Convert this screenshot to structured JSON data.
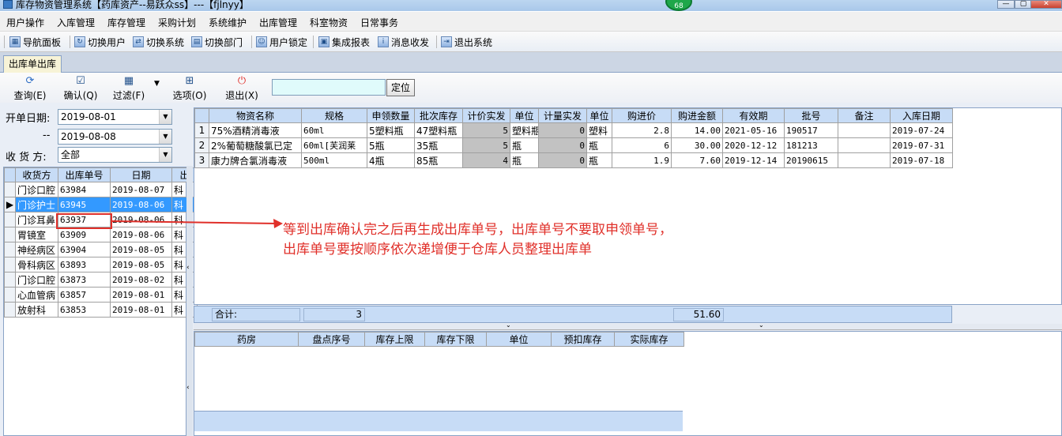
{
  "window": {
    "title": "库存物资管理系统【药库资产--易跃众ss】---【fjlnyy】",
    "badge": "68"
  },
  "menu": [
    "用户操作",
    "入库管理",
    "库存管理",
    "采购计划",
    "系统维护",
    "出库管理",
    "科室物资",
    "日常事务"
  ],
  "toolbar": [
    "导航面板",
    "切换用户",
    "切换系统",
    "切换部门",
    "用户锁定",
    "集成报表",
    "消息收发",
    "退出系统"
  ],
  "tab_label": "出库单出库",
  "actions": [
    {
      "label": "查询(E)",
      "icon": "refresh-icon"
    },
    {
      "label": "确认(Q)",
      "icon": "checkbox-icon"
    },
    {
      "label": "过滤(F)",
      "icon": "filter-icon"
    },
    {
      "label": "选项(O)",
      "icon": "options-icon"
    },
    {
      "label": "退出(X)",
      "icon": "power-icon"
    }
  ],
  "locate_button": "定位",
  "filters": {
    "start_date_label": "开单日期:",
    "start_date": "2019-08-01",
    "dash_label": "--",
    "end_date": "2019-08-08",
    "receiver_label": "收 货 方:",
    "receiver_value": "全部"
  },
  "left_grid": {
    "headers": [
      "收货方",
      "出库单号",
      "日期",
      "出"
    ],
    "rows": [
      [
        "门诊口腔",
        "63984",
        "2019-08-07",
        "科"
      ],
      [
        "门诊护士",
        "63945",
        "2019-08-06",
        "科"
      ],
      [
        "门诊耳鼻",
        "63937",
        "2019-08-06",
        "科"
      ],
      [
        "胃镜室",
        "63909",
        "2019-08-06",
        "科"
      ],
      [
        "神经病区",
        "63904",
        "2019-08-05",
        "科"
      ],
      [
        "骨科病区",
        "63893",
        "2019-08-05",
        "科"
      ],
      [
        "门诊口腔",
        "63873",
        "2019-08-02",
        "科"
      ],
      [
        "心血管病",
        "63857",
        "2019-08-01",
        "科"
      ],
      [
        "放射科",
        "63853",
        "2019-08-01",
        "科"
      ]
    ]
  },
  "main_grid": {
    "headers": [
      "物资名称",
      "规格",
      "申领数量",
      "批次库存",
      "计价实发",
      "单位",
      "计量实发",
      "单位",
      "购进价",
      "购进金额",
      "有效期",
      "批号",
      "备注",
      "入库日期"
    ],
    "rows": [
      [
        "1",
        "75%酒精消毒液",
        "60ml",
        "5塑料瓶",
        "47塑料瓶",
        "5",
        "塑料瓶",
        "0",
        "塑料",
        "2.8",
        "14.00",
        "2021-05-16",
        "190517",
        "",
        "2019-07-24"
      ],
      [
        "2",
        "2%葡萄糖酸氯已定",
        "60ml[芙润莱",
        "5瓶",
        "35瓶",
        "5",
        "瓶",
        "0",
        "瓶",
        "6",
        "30.00",
        "2020-12-12",
        "181213",
        "",
        "2019-07-31"
      ],
      [
        "3",
        "康力牌合氯消毒液",
        "500ml",
        "4瓶",
        "85瓶",
        "4",
        "瓶",
        "0",
        "瓶",
        "1.9",
        "7.60",
        "2019-12-14",
        "20190615",
        "",
        "2019-07-18"
      ]
    ]
  },
  "summary": {
    "label": "合计:",
    "count": "3",
    "amount": "51.60"
  },
  "bottom_grid": {
    "headers": [
      "药房",
      "盘点序号",
      "库存上限",
      "库存下限",
      "单位",
      "预扣库存",
      "实际库存"
    ]
  },
  "annotation": {
    "line1": "等到出库确认完之后再生成出库单号，出库单号不要取申领单号，",
    "line2": "出库单号要按顺序依次递增便于仓库人员整理出库单"
  },
  "colors": {
    "annotation": "#e0302a",
    "header": "#c7dcf6",
    "selection": "#3399ff"
  }
}
